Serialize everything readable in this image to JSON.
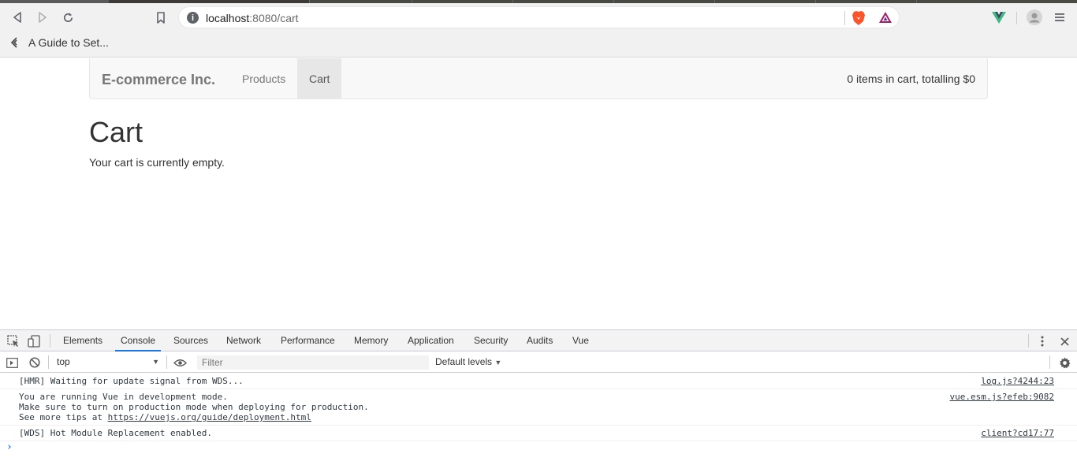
{
  "browser": {
    "url_host": "localhost",
    "url_rest": ":8080/cart",
    "bookmark_label": "A Guide to Set..."
  },
  "navbar": {
    "brand": "E-commerce Inc.",
    "links": [
      {
        "label": "Products",
        "active": false
      },
      {
        "label": "Cart",
        "active": true
      }
    ],
    "cart_summary": "0 items in cart, totalling $0"
  },
  "page": {
    "title": "Cart",
    "message": "Your cart is currently empty."
  },
  "devtools": {
    "tabs": [
      "Elements",
      "Console",
      "Sources",
      "Network",
      "Performance",
      "Memory",
      "Application",
      "Security",
      "Audits",
      "Vue"
    ],
    "active_tab": "Console",
    "context": "top",
    "filter_placeholder": "Filter",
    "levels_label": "Default levels",
    "logs": [
      {
        "lines": [
          "[HMR] Waiting for update signal from WDS..."
        ],
        "source": "log.js?4244:23"
      },
      {
        "lines": [
          "You are running Vue in development mode.",
          "Make sure to turn on production mode when deploying for production.",
          "See more tips at "
        ],
        "link": "https://vuejs.org/guide/deployment.html",
        "source": "vue.esm.js?efeb:9082"
      },
      {
        "lines": [
          "[WDS] Hot Module Replacement enabled."
        ],
        "source": "client?cd17:77"
      }
    ]
  },
  "colors": {
    "accent": "#1a73e8",
    "brave": "#fb542b",
    "vue": "#41b883"
  }
}
